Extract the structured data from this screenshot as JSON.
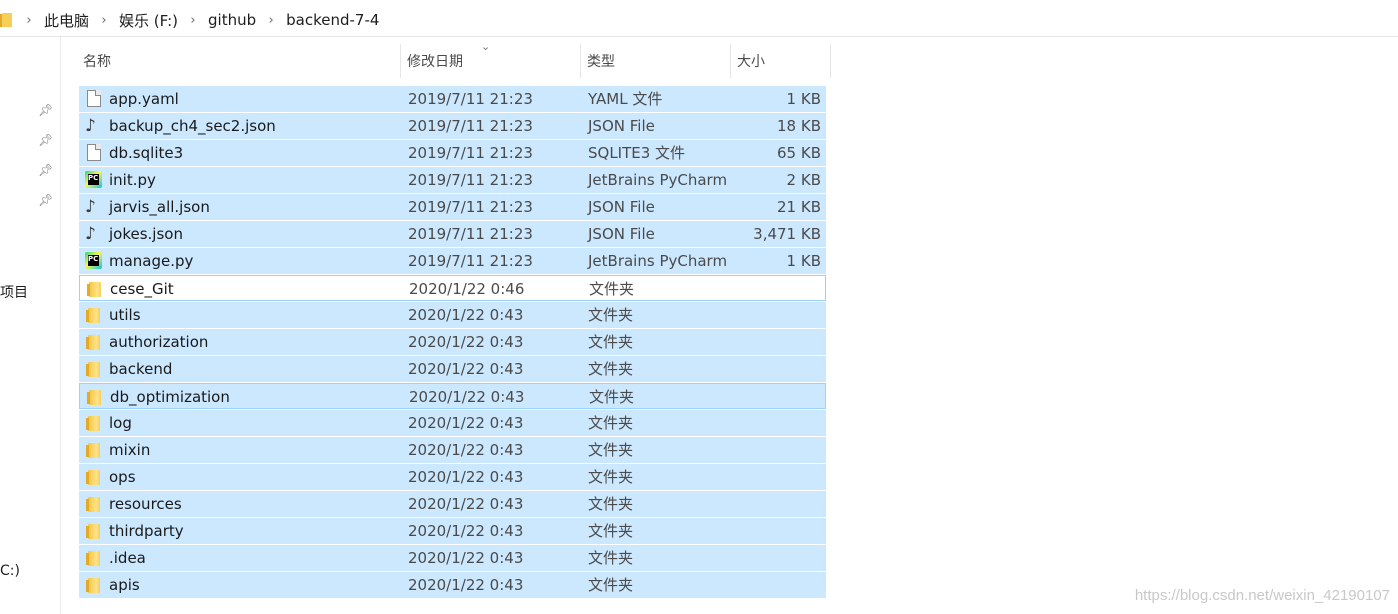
{
  "breadcrumb": {
    "items": [
      "此电脑",
      "娱乐 (F:)",
      "github",
      "backend-7-4"
    ]
  },
  "nav": {
    "partial_item_1": "项目",
    "partial_item_2": "C:)"
  },
  "columns": {
    "name": "名称",
    "date": "修改日期",
    "type": "类型",
    "size": "大小"
  },
  "files": [
    {
      "name": "app.yaml",
      "date": "2019/7/11 21:23",
      "type": "YAML 文件",
      "size": "1 KB",
      "icon": "file-icon"
    },
    {
      "name": "backup_ch4_sec2.json",
      "date": "2019/7/11 21:23",
      "type": "JSON File",
      "size": "18 KB",
      "icon": "json-file-icon"
    },
    {
      "name": "db.sqlite3",
      "date": "2019/7/11 21:23",
      "type": "SQLITE3 文件",
      "size": "65 KB",
      "icon": "file-icon"
    },
    {
      "name": "init.py",
      "date": "2019/7/11 21:23",
      "type": "JetBrains PyCharm",
      "size": "2 KB",
      "icon": "pycharm-icon"
    },
    {
      "name": "jarvis_all.json",
      "date": "2019/7/11 21:23",
      "type": "JSON File",
      "size": "21 KB",
      "icon": "json-file-icon"
    },
    {
      "name": "jokes.json",
      "date": "2019/7/11 21:23",
      "type": "JSON File",
      "size": "3,471 KB",
      "icon": "json-file-icon"
    },
    {
      "name": "manage.py",
      "date": "2019/7/11 21:23",
      "type": "JetBrains PyCharm",
      "size": "1 KB",
      "icon": "pycharm-icon"
    },
    {
      "name": "cese_Git",
      "date": "2020/1/22 0:46",
      "type": "文件夹",
      "size": "",
      "icon": "folder-icon"
    },
    {
      "name": "utils",
      "date": "2020/1/22 0:43",
      "type": "文件夹",
      "size": "",
      "icon": "folder-icon"
    },
    {
      "name": "authorization",
      "date": "2020/1/22 0:43",
      "type": "文件夹",
      "size": "",
      "icon": "folder-icon"
    },
    {
      "name": "backend",
      "date": "2020/1/22 0:43",
      "type": "文件夹",
      "size": "",
      "icon": "folder-icon"
    },
    {
      "name": "db_optimization",
      "date": "2020/1/22 0:43",
      "type": "文件夹",
      "size": "",
      "icon": "folder-icon"
    },
    {
      "name": "log",
      "date": "2020/1/22 0:43",
      "type": "文件夹",
      "size": "",
      "icon": "folder-icon"
    },
    {
      "name": "mixin",
      "date": "2020/1/22 0:43",
      "type": "文件夹",
      "size": "",
      "icon": "folder-icon"
    },
    {
      "name": "ops",
      "date": "2020/1/22 0:43",
      "type": "文件夹",
      "size": "",
      "icon": "folder-icon"
    },
    {
      "name": "resources",
      "date": "2020/1/22 0:43",
      "type": "文件夹",
      "size": "",
      "icon": "folder-icon"
    },
    {
      "name": "thirdparty",
      "date": "2020/1/22 0:43",
      "type": "文件夹",
      "size": "",
      "icon": "folder-icon"
    },
    {
      "name": ".idea",
      "date": "2020/1/22 0:43",
      "type": "文件夹",
      "size": "",
      "icon": "folder-icon"
    },
    {
      "name": "apis",
      "date": "2020/1/22 0:43",
      "type": "文件夹",
      "size": "",
      "icon": "folder-icon"
    }
  ],
  "selection": {
    "unselected_row_name": "cese_Git",
    "hover_row_name": "db_optimization",
    "selected_color": "#cce8ff",
    "border_color": "#99d1ff"
  },
  "watermark": "https://blog.csdn.net/weixin_42190107"
}
